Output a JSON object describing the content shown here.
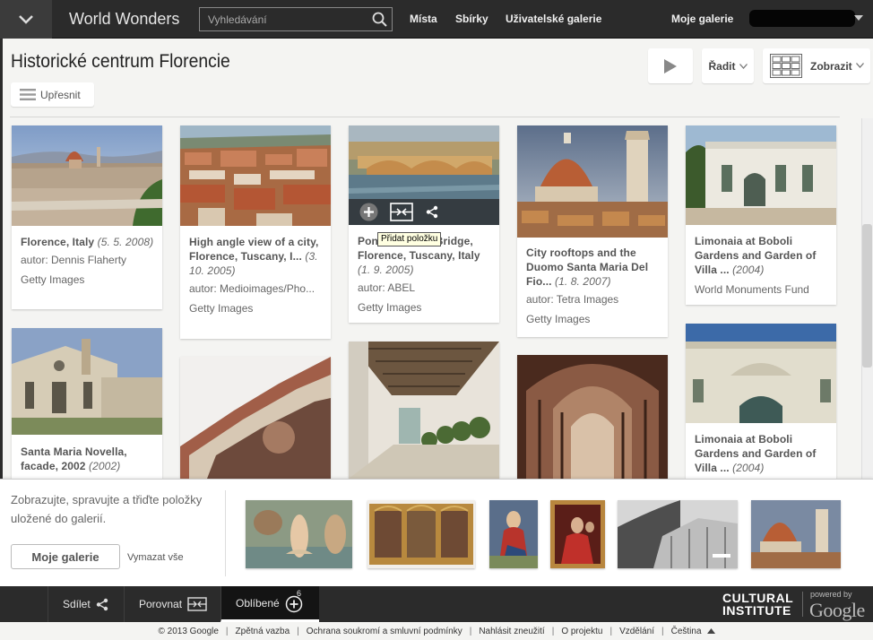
{
  "header": {
    "brand": "World Wonders",
    "search_placeholder": "Vyhledávání",
    "nav": [
      "Místa",
      "Sbírky",
      "Uživatelské galerie"
    ],
    "user_menu": "Moje galerie"
  },
  "page": {
    "title": "Historické centrum Florencie",
    "refine_label": "Upřesnit",
    "sort_label": "Řadit",
    "view_label": "Zobrazit"
  },
  "cards": [
    {
      "title": "Florence, Italy",
      "date": "(5. 5. 2008)",
      "author": "autor: Dennis Flaherty",
      "source": "Getty Images"
    },
    {
      "title": "High angle view of a city, Florence, Tuscany, I...",
      "date": "(3. 10. 2005)",
      "author": "autor: Medioimages/Pho...",
      "source": "Getty Images"
    },
    {
      "title": "Ponte Vecchio Bridge, Florence, Tuscany, Italy",
      "date": "(1. 9. 2005)",
      "author": "autor: ABEL",
      "source": "Getty Images"
    },
    {
      "title": "City rooftops and the Duomo Santa Maria Del Fio...",
      "date": "(1. 8. 2007)",
      "author": "autor: Tetra Images",
      "source": "Getty Images"
    },
    {
      "title": "Limonaia at Boboli Gardens and Garden of Villa ...",
      "date": "(2004)",
      "source": "World Monuments Fund"
    },
    {
      "title": "Santa Maria Novella, facade, 2002",
      "date": "(2002)"
    },
    {
      "title": "Limonaia at Boboli Gardens and Garden of Villa ...",
      "date": "(2004)"
    }
  ],
  "tooltip": "Přidat položku",
  "tray": {
    "text": "Zobrazujte, spravujte a třiďte položky uložené do galerií.",
    "button": "Moje galerie",
    "clear": "Vymazat vše"
  },
  "bottom_bar": {
    "tabs": [
      "Sdílet",
      "Porovnat",
      "Oblíbené"
    ],
    "favorites_count": "6",
    "logo_line1": "CULTURAL",
    "logo_line2": "INSTITUTE",
    "powered_by": "powered by",
    "google": "Google"
  },
  "footer": [
    "© 2013 Google",
    "Zpětná vazba",
    "Ochrana soukromí a smluvní podmínky",
    "Nahlásit zneužití",
    "O projektu",
    "Vzdělání",
    "Čeština"
  ],
  "icons": [
    "chevron-down-icon",
    "search-icon",
    "play-icon",
    "grid-view-icon",
    "list-icon",
    "add-icon",
    "compare-icon",
    "share-icon",
    "caret-up-icon"
  ]
}
